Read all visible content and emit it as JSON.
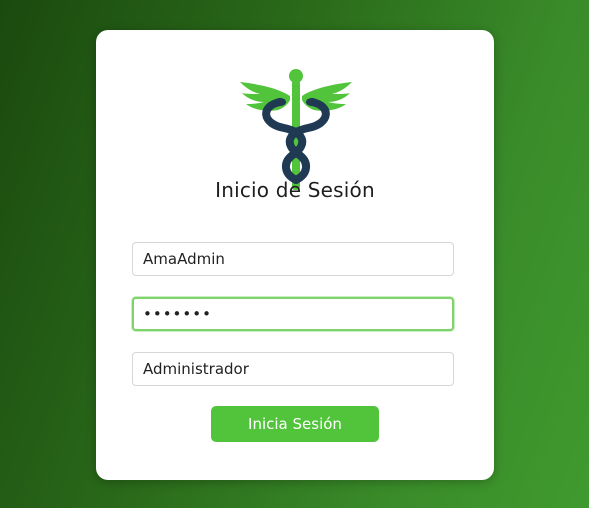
{
  "login": {
    "title": "Inicio de Sesión",
    "username_value": "AmaAdmin",
    "password_value": "1234567",
    "role_value": "Administrador",
    "submit_label": "Inicia Sesión"
  },
  "logo": {
    "icon": "caduceus-icon",
    "wing_color": "#52c43c",
    "staff_color": "#1f3a52"
  },
  "colors": {
    "background_start": "#1b4a0f",
    "background_end": "#3f9a2e",
    "button": "#52c43c",
    "focus_border": "#7ed36a"
  }
}
